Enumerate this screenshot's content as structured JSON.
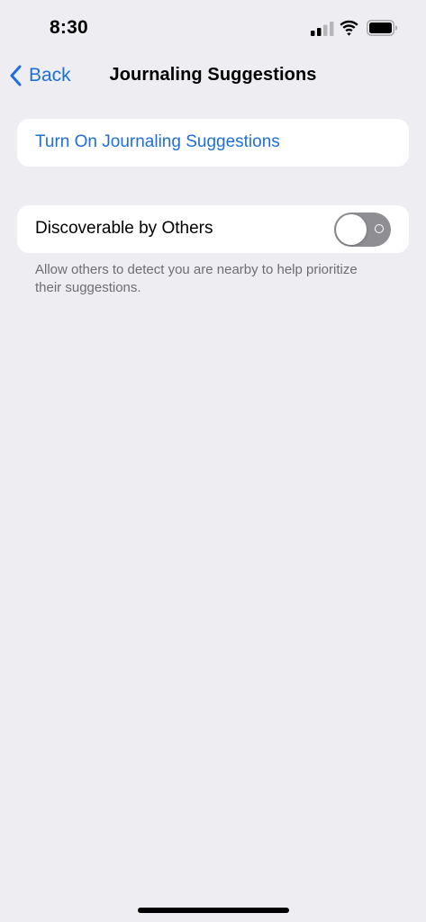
{
  "status_bar": {
    "time": "8:30",
    "signal_icon": "cellular-signal-icon",
    "wifi_icon": "wifi-icon",
    "battery_icon": "battery-icon"
  },
  "nav": {
    "back_label": "Back",
    "back_icon": "chevron-left-icon",
    "title": "Journaling Suggestions"
  },
  "settings": {
    "turn_on_label": "Turn On Journaling Suggestions",
    "discoverable": {
      "label": "Discoverable by Others",
      "enabled": false,
      "footer": "Allow others to detect you are nearby to help prioritize their suggestions."
    }
  },
  "colors": {
    "accent": "#1E6FD9",
    "background": "#EEEDF2",
    "cell": "#FFFFFF",
    "toggle_off": "#8E8E93",
    "secondary_text": "#6D6D72"
  }
}
